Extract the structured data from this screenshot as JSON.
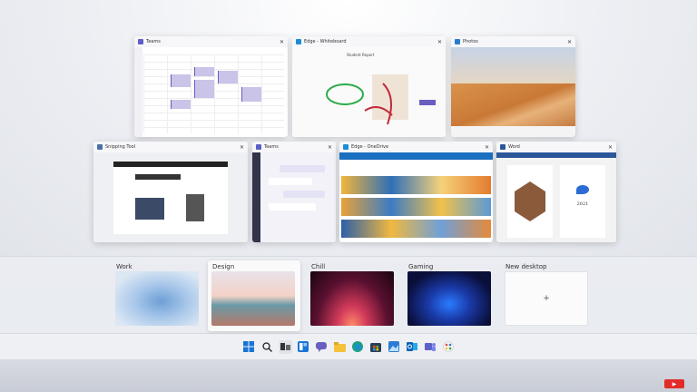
{
  "windows": [
    {
      "title": "Teams",
      "icon_color": "#5b5fc7"
    },
    {
      "title": "Edge - Whiteboard",
      "icon_color": "#1b8dd6"
    },
    {
      "title": "Photos",
      "icon_color": "#2b7bd4"
    },
    {
      "title": "Snipping Tool",
      "icon_color": "#4a6fa5"
    },
    {
      "title": "Teams",
      "icon_color": "#5b5fc7"
    },
    {
      "title": "Edge - OneDrive",
      "icon_color": "#1b8dd6"
    },
    {
      "title": "Word",
      "icon_color": "#2b579a"
    }
  ],
  "whiteboard_heading": "Student Report",
  "card_year": "2021",
  "desktops": [
    {
      "label": "Work"
    },
    {
      "label": "Design"
    },
    {
      "label": "Chill"
    },
    {
      "label": "Gaming"
    },
    {
      "label": "New desktop",
      "glyph": "+"
    }
  ],
  "taskbar": {
    "icons": [
      "start-icon",
      "search-icon",
      "task-view-icon",
      "widgets-icon",
      "chat-icon",
      "file-explorer-icon",
      "edge-icon",
      "store-icon",
      "photos-icon",
      "outlook-icon",
      "teams-icon",
      "paint-icon"
    ]
  },
  "colors": {
    "accent": "#2b6cd4",
    "teams": "#5b5fc7",
    "word": "#2b579a",
    "edge": "#1b8dd6"
  },
  "close_glyph": "✕"
}
